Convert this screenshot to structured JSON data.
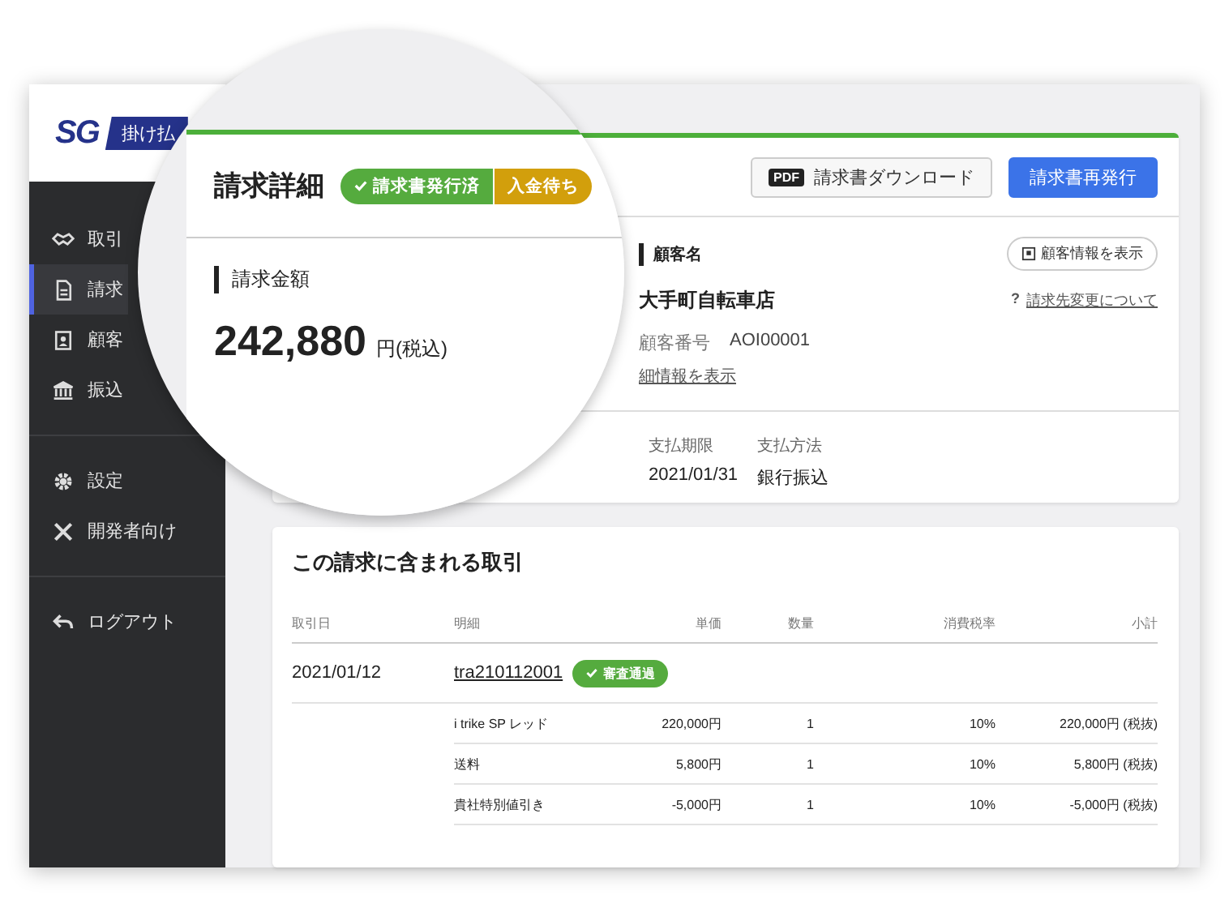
{
  "sidebar": {
    "logo": {
      "mark": "SG",
      "banner": "掛け払"
    },
    "groups": [
      [
        {
          "label": "取引",
          "selected": false
        },
        {
          "label": "請求",
          "selected": true
        },
        {
          "label": "顧客",
          "selected": false
        },
        {
          "label": "振込",
          "selected": false
        }
      ],
      [
        {
          "label": "設定",
          "selected": false
        },
        {
          "label": "開発者向け",
          "selected": false
        }
      ],
      [
        {
          "label": "ログアウト",
          "selected": false
        }
      ]
    ]
  },
  "magnifier": {
    "title": "請求詳細",
    "statuses": [
      {
        "label": "請求書発行済",
        "color": "#55ab3e",
        "checked": true
      },
      {
        "label": "入金待ち",
        "color": "#d29f0c",
        "checked": false
      }
    ],
    "amount_label": "請求金額",
    "amount": "242,880",
    "amount_unit": "円(税込)"
  },
  "invoice": {
    "actions": [
      {
        "label": "請求書ダウンロード",
        "kind": "secondary",
        "tag": "PDF"
      },
      {
        "label": "請求書再発行",
        "kind": "primary"
      }
    ],
    "customer": {
      "heading": "顧客名",
      "info_button": "顧客情報を表示",
      "name": "大手町自転車店",
      "help_mark": "?",
      "help_link": "請求先変更について",
      "number_label": "顧客番号",
      "number": "AOI00001",
      "detail_link": "細情報を表示"
    },
    "payment": [
      {
        "label": "支払期限",
        "value": "2021/01/31"
      },
      {
        "label": "支払方法",
        "value": "銀行振込"
      }
    ]
  },
  "transactions": {
    "title": "この請求に含まれる取引",
    "columns": [
      "取引日",
      "明細",
      "単価",
      "数量",
      "消費税率",
      "小計"
    ],
    "groups": [
      {
        "date": "2021/01/12",
        "id": "tra210112001",
        "status": "審査通過",
        "lines": [
          {
            "item": "i trike SP レッド",
            "unit_price": "220,000円",
            "quantity": "1",
            "tax_rate": "10%",
            "subtotal": "220,000円 (税抜)"
          },
          {
            "item": "送料",
            "unit_price": "5,800円",
            "quantity": "1",
            "tax_rate": "10%",
            "subtotal": "5,800円 (税抜)"
          },
          {
            "item": "貴社特別値引き",
            "unit_price": "-5,000円",
            "quantity": "1",
            "tax_rate": "10%",
            "subtotal": "-5,000円 (税抜)"
          }
        ]
      }
    ]
  }
}
